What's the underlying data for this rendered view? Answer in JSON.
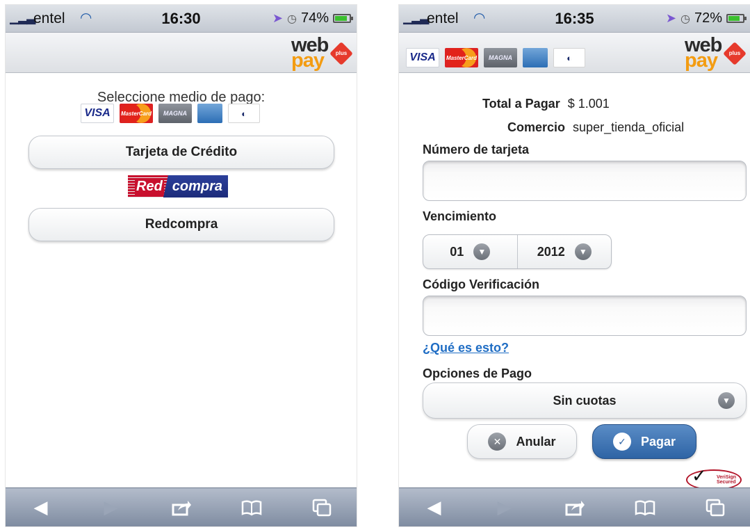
{
  "left": {
    "status": {
      "carrier": "entel",
      "time": "16:30",
      "battery": "74%",
      "battery_level": 0.74
    },
    "brand": {
      "line1": "web",
      "line2": "pay",
      "badge": "plus"
    },
    "select_title": "Seleccione medio de pago:",
    "cards": {
      "visa": "VISA",
      "mastercard": "MasterCard",
      "magna": "MAGNA",
      "amex": "AMERICAN EXPRESS",
      "diners": "Diners Club International"
    },
    "credit_button": "Tarjeta de Crédito",
    "redcompra_logo": {
      "red": "Red",
      "compra": "compra"
    },
    "redcompra_button": "Redcompra"
  },
  "right": {
    "status": {
      "carrier": "entel",
      "time": "16:35",
      "battery": "72%",
      "battery_level": 0.72
    },
    "brand": {
      "line1": "web",
      "line2": "pay",
      "badge": "plus"
    },
    "cards": {
      "visa": "VISA",
      "mastercard": "MasterCard",
      "magna": "MAGNA",
      "amex": "AMERICAN EXPRESS",
      "diners": "Diners Club International"
    },
    "total_label": "Total a Pagar",
    "total_value": "$ 1.001",
    "commerce_label": "Comercio",
    "commerce_value": "super_tienda_oficial",
    "card_number_label": "Número de tarjeta",
    "card_number_value": "",
    "expiry_label": "Vencimiento",
    "expiry_month": "01",
    "expiry_year": "2012",
    "cvv_label": "Código Verificación",
    "cvv_value": "",
    "cvv_help_link": "¿Qué es esto?",
    "payment_options_label": "Opciones de Pago",
    "payment_option_selected": "Sin cuotas",
    "cancel_button": "Anular",
    "pay_button": "Pagar",
    "verisign": {
      "line1": "VeriSign",
      "line2": "Secured"
    }
  },
  "toolbar": {
    "back": "back-icon",
    "forward": "forward-icon",
    "share": "share-icon",
    "bookmarks": "bookmarks-icon",
    "tabs": "tabs-icon"
  },
  "colors": {
    "accent_blue": "#2e64a5",
    "link": "#1f6dc4",
    "webpay_orange": "#f39c12",
    "plus_red": "#e63a2c"
  }
}
